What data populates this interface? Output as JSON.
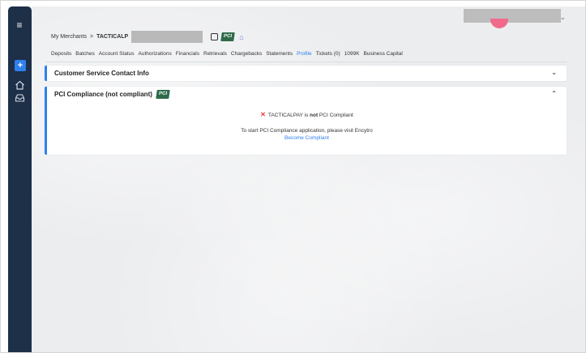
{
  "breadcrumb": {
    "root": "My Merchants",
    "sep": ">",
    "merchant": "TACTICALP"
  },
  "pci_badge_text": "PCI",
  "tabs": [
    {
      "label": "Deposits"
    },
    {
      "label": "Batches"
    },
    {
      "label": "Account Status"
    },
    {
      "label": "Authorizations"
    },
    {
      "label": "Financials"
    },
    {
      "label": "Retrievals"
    },
    {
      "label": "Chargebacks"
    },
    {
      "label": "Statements"
    },
    {
      "label": "Profile",
      "active": true
    },
    {
      "label": "Tickets (0)"
    },
    {
      "label": "1099K"
    },
    {
      "label": "Business Capital"
    }
  ],
  "panels": {
    "contact": {
      "title": "Customer Service Contact Info",
      "chevron": "⌄"
    },
    "pci": {
      "title": "PCI Compliance (not compliant)",
      "chevron": "⌃",
      "status_prefix": "TACTICALPAY is ",
      "status_bold": "not",
      "status_suffix": " PCI Compliant",
      "instruction": "To start PCI Compliance application, please visit Encytro",
      "link": "Become Compliant"
    }
  },
  "icons": {
    "menu": "hamburger-icon",
    "add": "plus-icon",
    "home": "home-icon",
    "inbox": "inbox-icon",
    "copy": "copy-icon",
    "bank": "bank-icon"
  },
  "colors": {
    "rail": "#1e2f48",
    "accent": "#2f80ed",
    "error": "#e53935",
    "avatar": "#f06b8b"
  }
}
